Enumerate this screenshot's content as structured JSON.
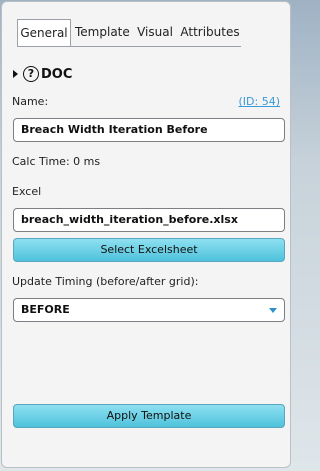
{
  "tabs": [
    {
      "label": "General",
      "active": true
    },
    {
      "label": "Template",
      "active": false
    },
    {
      "label": "Visual",
      "active": false
    },
    {
      "label": "Attributes",
      "active": false
    }
  ],
  "doc": {
    "icon": "question-circle-icon",
    "symbol": "?",
    "label": "DOC"
  },
  "name": {
    "label": "Name:",
    "id_link": "(ID: 54)",
    "value": "Breach Width Iteration Before"
  },
  "calc_time": "Calc Time: 0 ms",
  "excel": {
    "label": "Excel",
    "value": "breach_width_iteration_before.xlsx",
    "button": "Select Excelsheet"
  },
  "timing": {
    "label": "Update Timing (before/after grid):",
    "value": "BEFORE"
  },
  "apply_button": "Apply Template",
  "colors": {
    "accent": "#4fc2dc",
    "link": "#3a9ad9"
  }
}
